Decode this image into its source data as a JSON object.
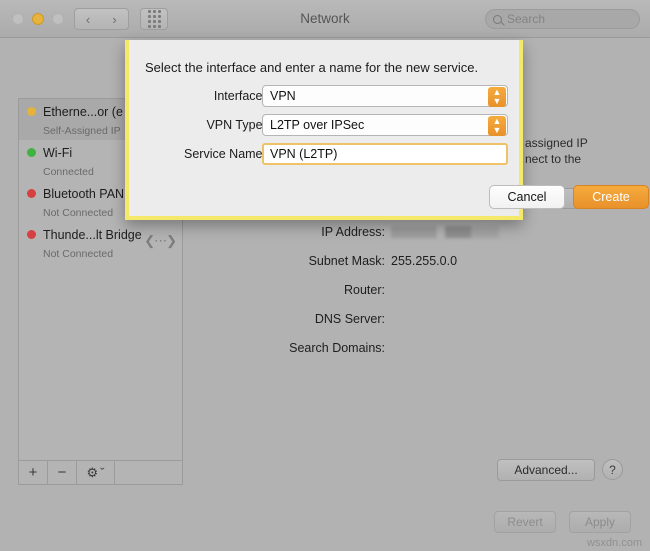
{
  "window": {
    "title": "Network",
    "traffic_lights": [
      "close",
      "minimize",
      "zoom"
    ],
    "nav_back": "‹",
    "nav_forward": "›",
    "grid_icon": "apps-grid-icon"
  },
  "search": {
    "placeholder": "Search",
    "value": ""
  },
  "sidebar": {
    "interfaces": [
      {
        "name": "Etherne...or (e",
        "status": "Self-Assigned IP",
        "dot": "#e5b23a",
        "selected": true,
        "thunderbolt": false
      },
      {
        "name": "Wi-Fi",
        "status": "Connected",
        "dot": "#3fb23f",
        "selected": false,
        "thunderbolt": false
      },
      {
        "name": "Bluetooth PAN",
        "status": "Not Connected",
        "dot": "#d64040",
        "selected": false,
        "thunderbolt": false
      },
      {
        "name": "Thunde...lt Bridge",
        "status": "Not Connected",
        "dot": "#d64040",
        "selected": false,
        "thunderbolt": true
      }
    ],
    "toolbar": {
      "add_label": "+",
      "remove_label": "−",
      "gear_label": "⚙",
      "gear_chevron": "ˇ"
    }
  },
  "detail": {
    "status_text_line1": "assigned IP",
    "status_text_line2": "nect to the",
    "fields": [
      {
        "label": "IP Address:",
        "value": "",
        "redacted": true
      },
      {
        "label": "Subnet Mask:",
        "value": "255.255.0.0",
        "redacted": false
      },
      {
        "label": "Router:",
        "value": "",
        "redacted": false
      },
      {
        "label": "DNS Server:",
        "value": "",
        "redacted": false
      },
      {
        "label": "Search Domains:",
        "value": "",
        "redacted": false
      }
    ],
    "advanced_label": "Advanced...",
    "help_label": "?",
    "revert_label": "Revert",
    "apply_label": "Apply"
  },
  "sheet": {
    "title": "Select the interface and enter a name for the new service.",
    "rows": [
      {
        "label": "Interface:",
        "value": "VPN",
        "kind": "popup"
      },
      {
        "label": "VPN Type:",
        "value": "L2TP over IPSec",
        "kind": "popup"
      },
      {
        "label": "Service Name:",
        "value": "VPN (L2TP)",
        "kind": "text"
      }
    ],
    "cancel_label": "Cancel",
    "create_label": "Create",
    "stepper_glyph": "⌃⌄",
    "border_color": "#f5e96a",
    "accent_color": "#e8912a"
  },
  "watermark": "wsxdn.com"
}
